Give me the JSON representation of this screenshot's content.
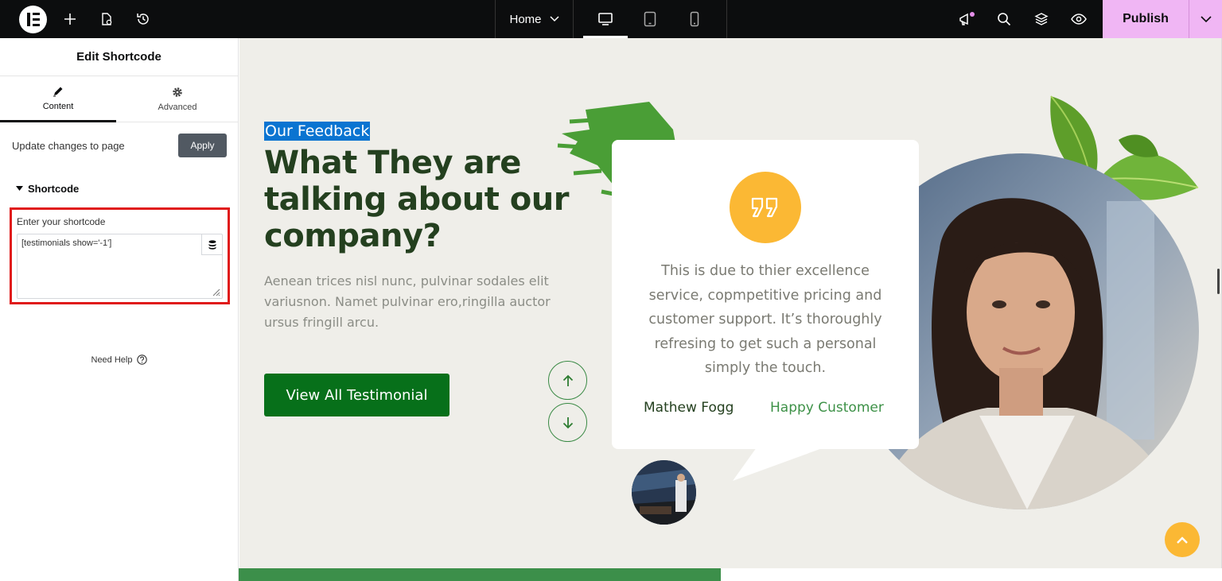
{
  "topbar": {
    "page_name": "Home",
    "publish_label": "Publish",
    "icons": [
      "elementor-logo-icon",
      "add-icon",
      "page-settings-icon",
      "history-icon",
      "desktop-icon",
      "tablet-icon",
      "mobile-icon",
      "notifications-icon",
      "search-icon",
      "structure-icon",
      "preview-icon",
      "chevron-down-icon"
    ]
  },
  "panel": {
    "title": "Edit Shortcode",
    "tabs": [
      {
        "label": "Content",
        "icon": "pencil-icon",
        "active": true
      },
      {
        "label": "Advanced",
        "icon": "gear-icon",
        "active": false
      }
    ],
    "update_label": "Update changes to page",
    "apply_label": "Apply",
    "section_title": "Shortcode",
    "shortcode_label": "Enter your shortcode",
    "shortcode_value": "[testimonials show='-1']",
    "need_help": "Need Help"
  },
  "canvas": {
    "kicker": "Our Feedback",
    "headline": "What They are talking about our company?",
    "description": "Aenean trices nisl nunc, pulvinar sodales elit variusnon. Namet pulvinar ero,ringilla auctor ursus fringill arcu.",
    "cta_label": "View All Testimonial",
    "testimonial": {
      "quote": "This is due to thier excellence service, copmpetitive pricing and customer support. It’s thoroughly refresing to get such a personal simply the touch.",
      "author": "Mathew Fogg",
      "role": "Happy Customer"
    }
  },
  "colors": {
    "publish": "#f0b6f4",
    "kicker_highlight": "#0a74d1",
    "headline": "#24401f",
    "cta": "#07701a",
    "accent_yellow": "#fbb834",
    "role_green": "#3d9147",
    "shortcode_outline": "#e01b1b"
  }
}
